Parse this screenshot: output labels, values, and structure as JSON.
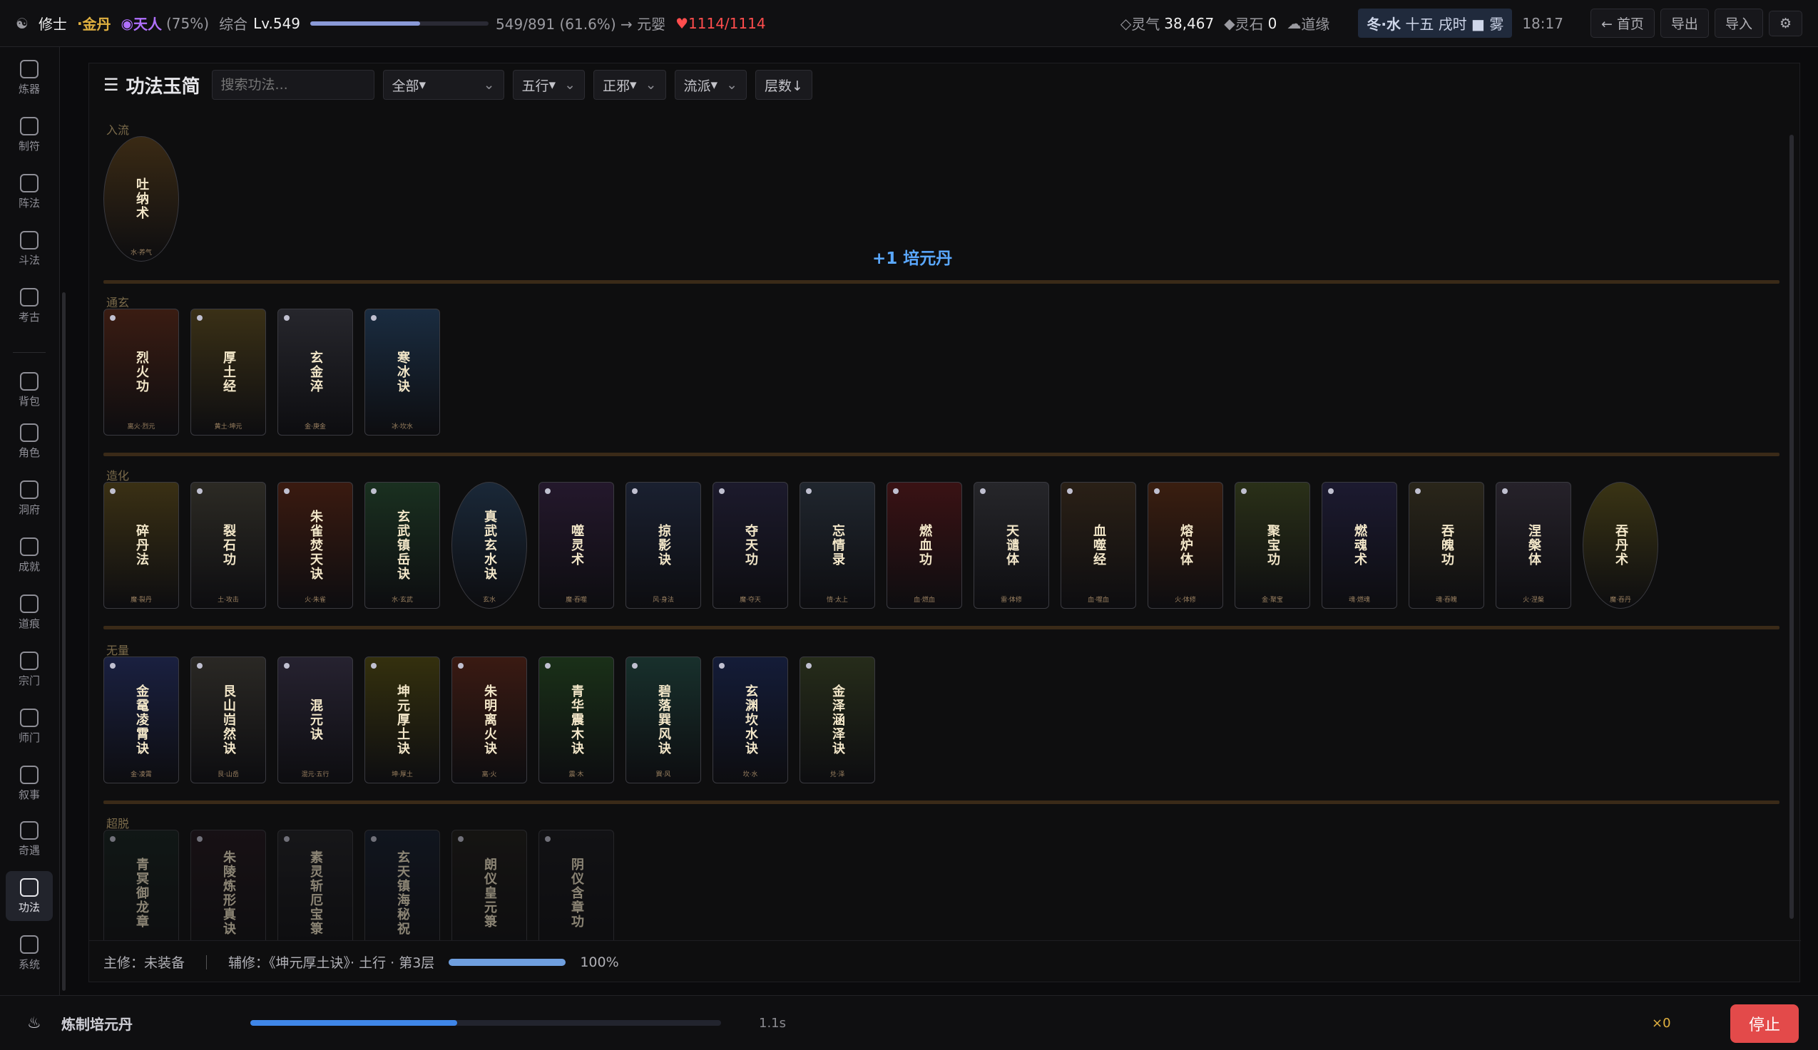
{
  "topbar": {
    "role": "修士",
    "sep": "·",
    "realm": "金丹",
    "heaven": "天人",
    "heaven_pct": "(75%)",
    "overall_label": "综合",
    "level": "Lv.549",
    "xp_fraction": 0.616,
    "xp_text": "549/891 (61.6%) → 元婴",
    "hp": "1114/1114",
    "qi_label": "灵气",
    "qi": "38,467",
    "stone_label": "灵石",
    "stone": "0",
    "fate": "道缘",
    "season": "冬·水",
    "day": "十五",
    "hour": "戌时",
    "weather": "雾",
    "time": "18:17",
    "btn_home": "← 首页",
    "btn_export": "导出",
    "btn_import": "导入",
    "btn_settings": "⚙"
  },
  "nav": [
    {
      "label": "炼器",
      "icon": "furnace-icon"
    },
    {
      "label": "制符",
      "icon": "talisman-icon"
    },
    {
      "label": "阵法",
      "icon": "formation-icon"
    },
    {
      "label": "斗法",
      "icon": "swords-icon"
    },
    {
      "label": "考古",
      "icon": "shovel-icon"
    },
    {
      "label": "背包",
      "icon": "bag-icon"
    },
    {
      "label": "角色",
      "icon": "person-icon"
    },
    {
      "label": "洞府",
      "icon": "cave-icon"
    },
    {
      "label": "成就",
      "icon": "star-icon"
    },
    {
      "label": "道痕",
      "icon": "wave-icon"
    },
    {
      "label": "宗门",
      "icon": "temple-icon"
    },
    {
      "label": "师门",
      "icon": "book-icon"
    },
    {
      "label": "叙事",
      "icon": "scroll-icon"
    },
    {
      "label": "奇遇",
      "icon": "compass-icon"
    },
    {
      "label": "功法",
      "icon": "jade-slip-icon"
    },
    {
      "label": "系统",
      "icon": "gear-icon"
    }
  ],
  "main": {
    "title": "功法玉简",
    "search_placeholder": "搜索功法...",
    "filters": [
      "全部",
      "五行",
      "正邪",
      "流派"
    ],
    "sort": "层数↓",
    "plus_msg": "+1 培元丹"
  },
  "tiers": [
    {
      "name": "入流",
      "cards": [
        {
          "name": "吐纳术",
          "sub": "水·养气",
          "color": "#3a2a14",
          "oval": true
        }
      ]
    },
    {
      "name": "通玄",
      "cards": [
        {
          "name": "烈火功",
          "sub": "离火·烈元",
          "color": "#3a1c12"
        },
        {
          "name": "厚土经",
          "sub": "黄土·坤元",
          "color": "#3a3016"
        },
        {
          "name": "玄金淬",
          "sub": "金·庚金",
          "color": "#26262c"
        },
        {
          "name": "寒冰诀",
          "sub": "冰·坎水",
          "color": "#1a2c40"
        }
      ]
    },
    {
      "name": "造化",
      "cards": [
        {
          "name": "碎丹法",
          "sub": "魔·裂丹",
          "color": "#3a3014"
        },
        {
          "name": "裂石功",
          "sub": "土·攻击",
          "color": "#2c2a24"
        },
        {
          "name": "朱雀焚天诀",
          "sub": "火·朱雀",
          "color": "#3a1a10"
        },
        {
          "name": "玄武镇岳诀",
          "sub": "水·玄武",
          "color": "#1a3020"
        },
        {
          "name": "真武玄水诀",
          "sub": "玄水",
          "color": "#1a2838",
          "oval": true
        },
        {
          "name": "噬灵术",
          "sub": "魔·吞噬",
          "color": "#24182c"
        },
        {
          "name": "掠影诀",
          "sub": "风·身法",
          "color": "#1a2030"
        },
        {
          "name": "夺天功",
          "sub": "魔·夺天",
          "color": "#1c1a2c"
        },
        {
          "name": "忘情录",
          "sub": "情·太上",
          "color": "#20262e"
        },
        {
          "name": "燃血功",
          "sub": "血·燃血",
          "color": "#3a1214"
        },
        {
          "name": "天谴体",
          "sub": "雷·体修",
          "color": "#26262a"
        },
        {
          "name": "血噬经",
          "sub": "血·噬血",
          "color": "#2a2016"
        },
        {
          "name": "熔炉体",
          "sub": "火·体修",
          "color": "#3a1e10"
        },
        {
          "name": "聚宝功",
          "sub": "金·聚宝",
          "color": "#2a3018"
        },
        {
          "name": "燃魂术",
          "sub": "魂·燃魂",
          "color": "#1c1a30"
        },
        {
          "name": "吞魄功",
          "sub": "魂·吞魄",
          "color": "#2a261a"
        },
        {
          "name": "涅槃体",
          "sub": "火·涅槃",
          "color": "#26222a"
        },
        {
          "name": "吞丹术",
          "sub": "魔·吞丹",
          "color": "#3a3414",
          "oval": true
        }
      ]
    },
    {
      "name": "无量",
      "cards": [
        {
          "name": "金鼋凌霄诀",
          "sub": "金·凌霄",
          "color": "#1a2040"
        },
        {
          "name": "艮山岿然诀",
          "sub": "艮·山岳",
          "color": "#2a2824"
        },
        {
          "name": "混元诀",
          "sub": "混元·五行",
          "color": "#262230"
        },
        {
          "name": "坤元厚土诀",
          "sub": "坤·厚土",
          "color": "#34300e"
        },
        {
          "name": "朱明离火诀",
          "sub": "离·火",
          "color": "#3a1a12"
        },
        {
          "name": "青华震木诀",
          "sub": "震·木",
          "color": "#1a3018"
        },
        {
          "name": "碧落巽风诀",
          "sub": "巽·风",
          "color": "#18302c"
        },
        {
          "name": "玄渊坎水诀",
          "sub": "坎·水",
          "color": "#141c38"
        },
        {
          "name": "金泽涵泽诀",
          "sub": "兑·泽",
          "color": "#262c1a"
        }
      ]
    },
    {
      "name": "超脱",
      "cards": [
        {
          "name": "青冥御龙章",
          "sub": "",
          "color": "#14201c"
        },
        {
          "name": "朱陵炼形真诀",
          "sub": "",
          "color": "#20141a"
        },
        {
          "name": "素灵斩厄宝箓",
          "sub": "",
          "color": "#1e1e22"
        },
        {
          "name": "玄天镇海秘祝",
          "sub": "",
          "color": "#141c2c"
        },
        {
          "name": "朗仪皇元箓",
          "sub": "",
          "color": "#1c1a16"
        },
        {
          "name": "阴仪含章功",
          "sub": "",
          "color": "#16161a"
        }
      ]
    }
  ],
  "footer": {
    "main_label": "主修：未装备",
    "aux_label": "辅修：《坤元厚土诀》· 土行 · 第3层",
    "progress_fraction": 1.0,
    "progress_text": "100%"
  },
  "bottom": {
    "task": "炼制培元丹",
    "progress_fraction": 0.44,
    "time": "1.1s",
    "count": "×0",
    "stop": "停止"
  }
}
